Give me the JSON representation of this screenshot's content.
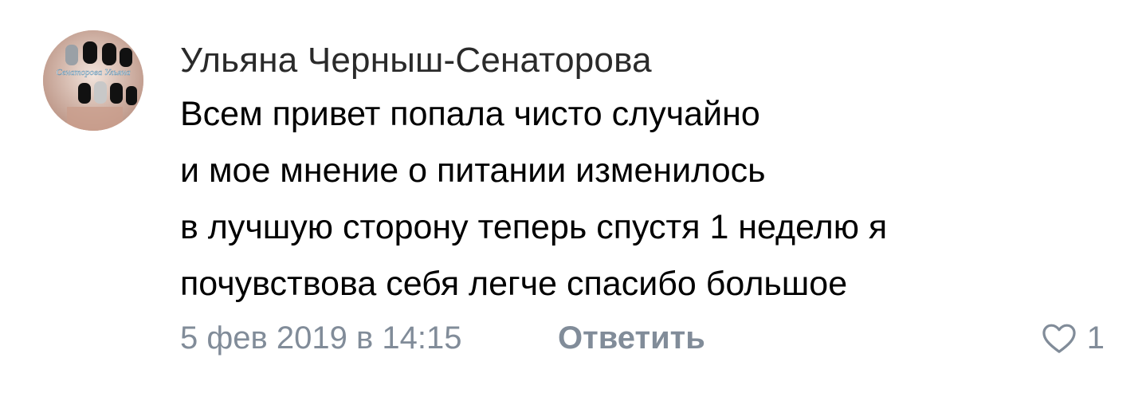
{
  "comment": {
    "author": "Ульяна Черныш-Сенаторова",
    "avatar_label": "Сенаторова Ульяна",
    "lines": [
      "Всем привет попала чисто случайно",
      "и мое мнение о питании изменилось",
      "в лучшую сторону теперь спустя 1 неделю я",
      "почувствова себя легче спасибо большое"
    ],
    "date": "5 фев 2019 в 14:15",
    "reply_label": "Ответить",
    "likes_count": "1",
    "like_icon": "heart-outline-icon"
  },
  "colors": {
    "meta": "#818c99",
    "author": "#2a2a2a",
    "text": "#000000"
  }
}
